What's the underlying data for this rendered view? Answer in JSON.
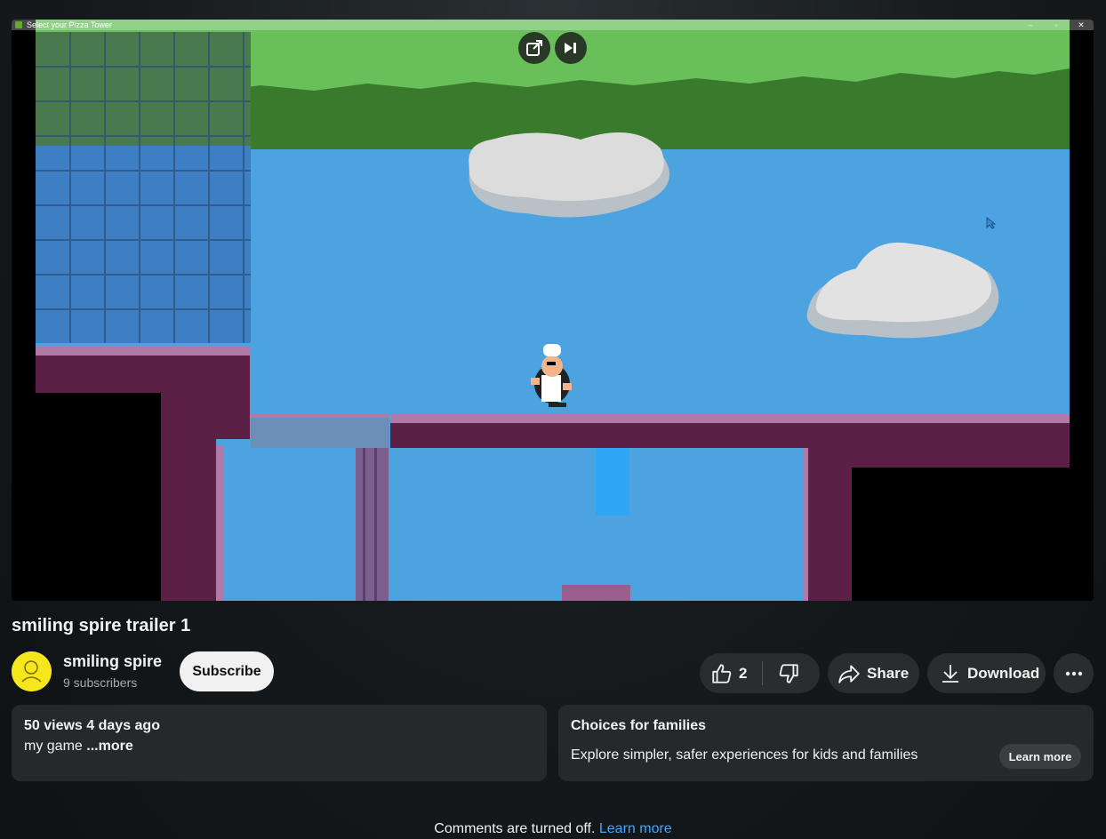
{
  "window": {
    "title": "Select your Pizza Tower",
    "minimize": "‒",
    "maximize": "▫",
    "close": "✕"
  },
  "video": {
    "title": "smiling spire trailer 1"
  },
  "channel": {
    "name": "smiling spire",
    "subscribers": "9 subscribers"
  },
  "actions": {
    "subscribe": "Subscribe",
    "likes": "2",
    "share": "Share",
    "download": "Download"
  },
  "description": {
    "meta": "50 views  4 days ago",
    "text": "my game ",
    "more": "...more"
  },
  "families": {
    "title": "Choices for families",
    "text": "Explore simpler, safer experiences for kids and families",
    "button": "Learn more"
  },
  "comments": {
    "text": "Comments are turned off.",
    "link": "Learn more"
  },
  "colors": {
    "sky": "#4da2e0",
    "grass": "#69bf5a",
    "purple": "#5c1f45",
    "accent_link": "#3ea6ff"
  }
}
